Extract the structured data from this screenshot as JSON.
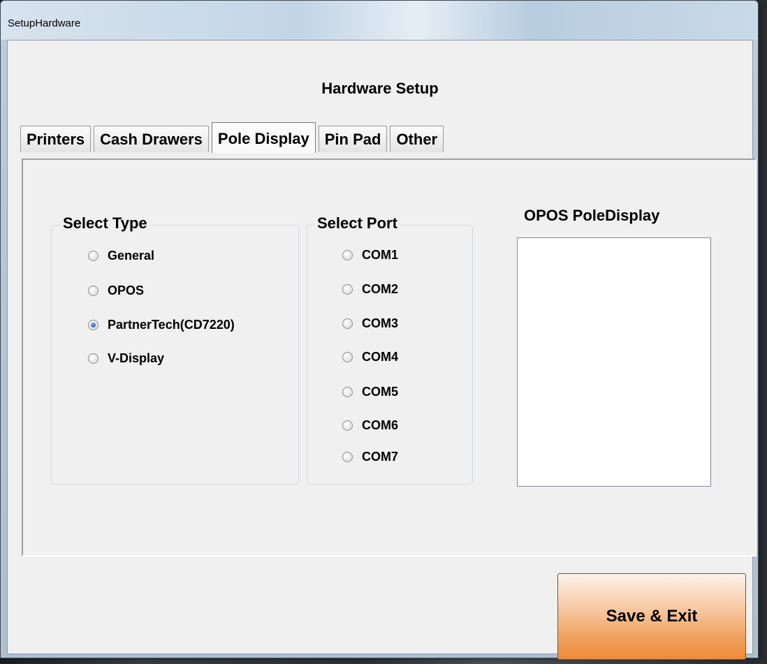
{
  "window": {
    "title": "SetupHardware"
  },
  "header": {
    "title": "Hardware Setup"
  },
  "tabs": [
    {
      "label": "Printers",
      "active": false
    },
    {
      "label": "Cash Drawers",
      "active": false
    },
    {
      "label": "Pole Display",
      "active": true
    },
    {
      "label": "Pin Pad",
      "active": false
    },
    {
      "label": "Other",
      "active": false
    }
  ],
  "select_type": {
    "title": "Select Type",
    "options": [
      "General",
      "OPOS",
      "PartnerTech(CD7220)",
      "V-Display"
    ],
    "selected": "PartnerTech(CD7220)"
  },
  "select_port": {
    "title": "Select Port",
    "options": [
      "COM1",
      "COM2",
      "COM3",
      "COM4",
      "COM5",
      "COM6",
      "COM7"
    ],
    "selected": null
  },
  "opos": {
    "title": "OPOS PoleDisplay",
    "items": []
  },
  "actions": {
    "save_label": "Save & Exit"
  },
  "colors": {
    "save_button": "#f0a15e",
    "radio_checked": "#0b4f9e"
  }
}
